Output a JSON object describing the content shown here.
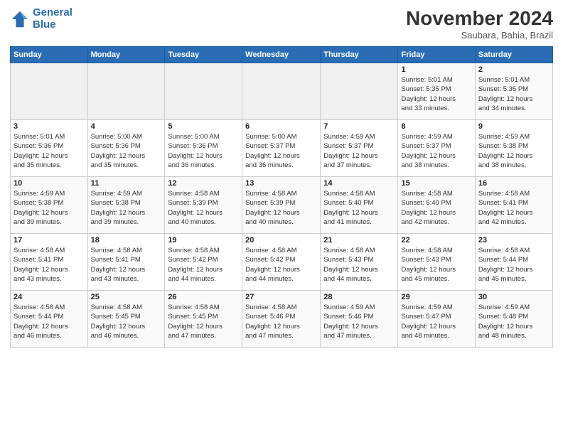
{
  "logo": {
    "line1": "General",
    "line2": "Blue"
  },
  "title": "November 2024",
  "location": "Saubara, Bahia, Brazil",
  "weekdays": [
    "Sunday",
    "Monday",
    "Tuesday",
    "Wednesday",
    "Thursday",
    "Friday",
    "Saturday"
  ],
  "weeks": [
    [
      {
        "day": "",
        "info": ""
      },
      {
        "day": "",
        "info": ""
      },
      {
        "day": "",
        "info": ""
      },
      {
        "day": "",
        "info": ""
      },
      {
        "day": "",
        "info": ""
      },
      {
        "day": "1",
        "info": "Sunrise: 5:01 AM\nSunset: 5:35 PM\nDaylight: 12 hours\nand 33 minutes."
      },
      {
        "day": "2",
        "info": "Sunrise: 5:01 AM\nSunset: 5:35 PM\nDaylight: 12 hours\nand 34 minutes."
      }
    ],
    [
      {
        "day": "3",
        "info": "Sunrise: 5:01 AM\nSunset: 5:36 PM\nDaylight: 12 hours\nand 35 minutes."
      },
      {
        "day": "4",
        "info": "Sunrise: 5:00 AM\nSunset: 5:36 PM\nDaylight: 12 hours\nand 35 minutes."
      },
      {
        "day": "5",
        "info": "Sunrise: 5:00 AM\nSunset: 5:36 PM\nDaylight: 12 hours\nand 36 minutes."
      },
      {
        "day": "6",
        "info": "Sunrise: 5:00 AM\nSunset: 5:37 PM\nDaylight: 12 hours\nand 36 minutes."
      },
      {
        "day": "7",
        "info": "Sunrise: 4:59 AM\nSunset: 5:37 PM\nDaylight: 12 hours\nand 37 minutes."
      },
      {
        "day": "8",
        "info": "Sunrise: 4:59 AM\nSunset: 5:37 PM\nDaylight: 12 hours\nand 38 minutes."
      },
      {
        "day": "9",
        "info": "Sunrise: 4:59 AM\nSunset: 5:38 PM\nDaylight: 12 hours\nand 38 minutes."
      }
    ],
    [
      {
        "day": "10",
        "info": "Sunrise: 4:59 AM\nSunset: 5:38 PM\nDaylight: 12 hours\nand 39 minutes."
      },
      {
        "day": "11",
        "info": "Sunrise: 4:59 AM\nSunset: 5:38 PM\nDaylight: 12 hours\nand 39 minutes."
      },
      {
        "day": "12",
        "info": "Sunrise: 4:58 AM\nSunset: 5:39 PM\nDaylight: 12 hours\nand 40 minutes."
      },
      {
        "day": "13",
        "info": "Sunrise: 4:58 AM\nSunset: 5:39 PM\nDaylight: 12 hours\nand 40 minutes."
      },
      {
        "day": "14",
        "info": "Sunrise: 4:58 AM\nSunset: 5:40 PM\nDaylight: 12 hours\nand 41 minutes."
      },
      {
        "day": "15",
        "info": "Sunrise: 4:58 AM\nSunset: 5:40 PM\nDaylight: 12 hours\nand 42 minutes."
      },
      {
        "day": "16",
        "info": "Sunrise: 4:58 AM\nSunset: 5:41 PM\nDaylight: 12 hours\nand 42 minutes."
      }
    ],
    [
      {
        "day": "17",
        "info": "Sunrise: 4:58 AM\nSunset: 5:41 PM\nDaylight: 12 hours\nand 43 minutes."
      },
      {
        "day": "18",
        "info": "Sunrise: 4:58 AM\nSunset: 5:41 PM\nDaylight: 12 hours\nand 43 minutes."
      },
      {
        "day": "19",
        "info": "Sunrise: 4:58 AM\nSunset: 5:42 PM\nDaylight: 12 hours\nand 44 minutes."
      },
      {
        "day": "20",
        "info": "Sunrise: 4:58 AM\nSunset: 5:42 PM\nDaylight: 12 hours\nand 44 minutes."
      },
      {
        "day": "21",
        "info": "Sunrise: 4:58 AM\nSunset: 5:43 PM\nDaylight: 12 hours\nand 44 minutes."
      },
      {
        "day": "22",
        "info": "Sunrise: 4:58 AM\nSunset: 5:43 PM\nDaylight: 12 hours\nand 45 minutes."
      },
      {
        "day": "23",
        "info": "Sunrise: 4:58 AM\nSunset: 5:44 PM\nDaylight: 12 hours\nand 45 minutes."
      }
    ],
    [
      {
        "day": "24",
        "info": "Sunrise: 4:58 AM\nSunset: 5:44 PM\nDaylight: 12 hours\nand 46 minutes."
      },
      {
        "day": "25",
        "info": "Sunrise: 4:58 AM\nSunset: 5:45 PM\nDaylight: 12 hours\nand 46 minutes."
      },
      {
        "day": "26",
        "info": "Sunrise: 4:58 AM\nSunset: 5:45 PM\nDaylight: 12 hours\nand 47 minutes."
      },
      {
        "day": "27",
        "info": "Sunrise: 4:58 AM\nSunset: 5:46 PM\nDaylight: 12 hours\nand 47 minutes."
      },
      {
        "day": "28",
        "info": "Sunrise: 4:59 AM\nSunset: 5:46 PM\nDaylight: 12 hours\nand 47 minutes."
      },
      {
        "day": "29",
        "info": "Sunrise: 4:59 AM\nSunset: 5:47 PM\nDaylight: 12 hours\nand 48 minutes."
      },
      {
        "day": "30",
        "info": "Sunrise: 4:59 AM\nSunset: 5:48 PM\nDaylight: 12 hours\nand 48 minutes."
      }
    ]
  ]
}
